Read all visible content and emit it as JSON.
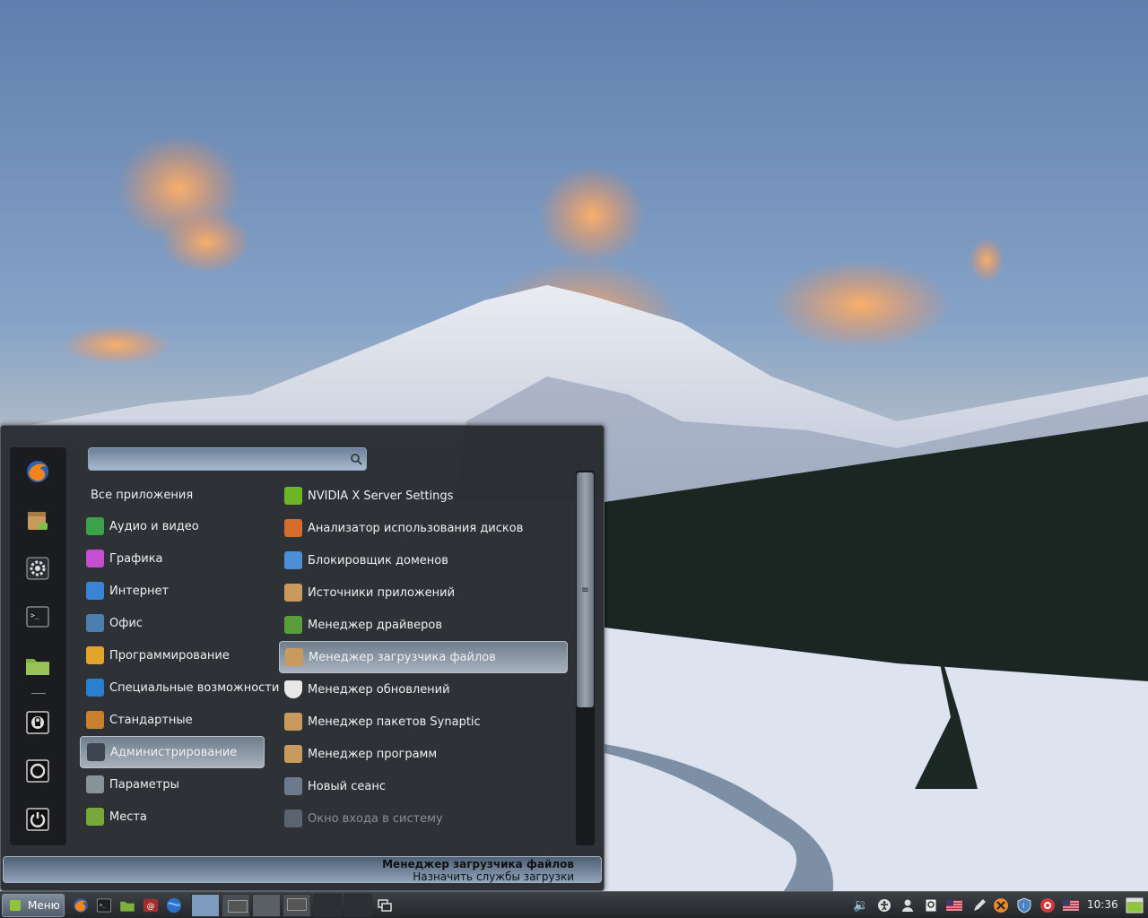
{
  "search": {
    "value": "",
    "placeholder": ""
  },
  "menu": {
    "all_apps_label": "Все приложения",
    "categories": [
      {
        "label": "Аудио и видео",
        "icon": "audio-video-icon",
        "color": "#3aa34a"
      },
      {
        "label": "Графика",
        "icon": "graphics-icon",
        "color": "#c44fd0"
      },
      {
        "label": "Интернет",
        "icon": "internet-icon",
        "color": "#3a84d8"
      },
      {
        "label": "Офис",
        "icon": "office-icon",
        "color": "#4a7fb0"
      },
      {
        "label": "Программирование",
        "icon": "programming-icon",
        "color": "#e2a52a"
      },
      {
        "label": "Специальные возможности",
        "icon": "accessibility-icon",
        "color": "#2b7fd0"
      },
      {
        "label": "Стандартные",
        "icon": "accessories-icon",
        "color": "#c9812f"
      },
      {
        "label": "Администрирование",
        "icon": "administration-icon",
        "color": "#3d4650"
      },
      {
        "label": "Параметры",
        "icon": "settings-icon",
        "color": "#8a9299"
      },
      {
        "label": "Места",
        "icon": "folder-icon",
        "color": "#78a83a"
      }
    ],
    "apps": [
      {
        "label": "NVIDIA X Server Settings",
        "icon": "nvidia-icon",
        "color": "#6cb524"
      },
      {
        "label": "Анализатор использования дисков",
        "icon": "disk-usage-icon",
        "color": "#d66c2c"
      },
      {
        "label": "Блокировщик доменов",
        "icon": "domain-blocker-icon",
        "color": "#4d8fd6"
      },
      {
        "label": "Источники приложений",
        "icon": "software-sources-icon",
        "color": "#c89a5e"
      },
      {
        "label": "Менеджер драйверов",
        "icon": "driver-manager-icon",
        "color": "#5b9d3a"
      },
      {
        "label": "Менеджер загрузчика файлов",
        "icon": "boot-manager-icon",
        "color": "#c89a5e"
      },
      {
        "label": "Менеджер обновлений",
        "icon": "shield-icon",
        "color": "#e8e8e8"
      },
      {
        "label": "Менеджер пакетов Synaptic",
        "icon": "synaptic-icon",
        "color": "#c89a5e"
      },
      {
        "label": "Менеджер программ",
        "icon": "software-manager-icon",
        "color": "#c89a5e"
      },
      {
        "label": "Новый сеанс",
        "icon": "new-session-icon",
        "color": "#6b7a8c"
      },
      {
        "label": "Окно входа в систему",
        "icon": "login-window-icon",
        "color": "#5a6470"
      }
    ],
    "description": {
      "title": "Менеджер загрузчика файлов",
      "subtitle": "Назначить службы загрузки"
    }
  },
  "favorites": [
    "firefox-icon",
    "software-manager-icon",
    "system-settings-icon",
    "terminal-icon",
    "files-folder-icon",
    "lock-screen-icon",
    "logout-icon",
    "shutdown-icon"
  ],
  "panel": {
    "menu_label": "Меню",
    "clock": "10:36",
    "launchers": [
      "firefox-icon",
      "terminal-icon",
      "files-icon",
      "mail-icon",
      "browser-icon"
    ],
    "tray": [
      "volume-icon",
      "accessibility-icon",
      "user-icon",
      "notes-icon",
      "flag-us-icon",
      "pen-icon",
      "close-circle-icon",
      "shield-icon",
      "help-icon",
      "keyboard-layout-icon"
    ]
  },
  "colors": {
    "accent": "#8da2ba",
    "menu_bg": "#22262a",
    "panel_bg": "#2e3236"
  }
}
